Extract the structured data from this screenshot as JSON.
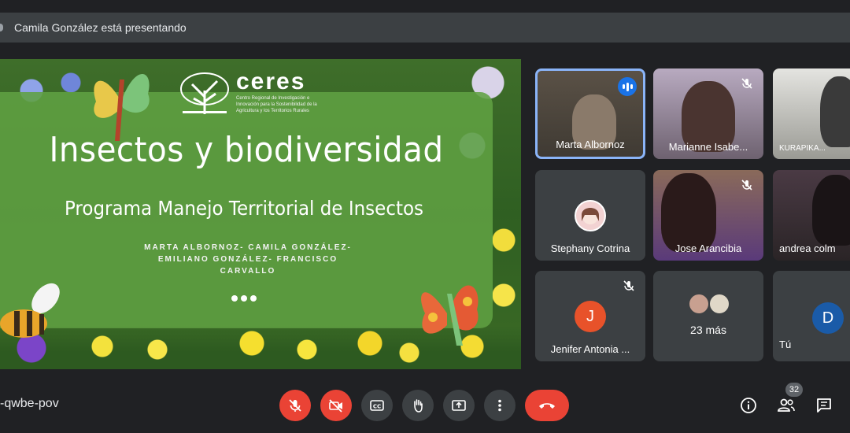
{
  "presenting": {
    "text": "Camila González está presentando"
  },
  "slide": {
    "logo_name": "ceres",
    "logo_subtitle": "Centro Regional de Investigación e Innovación para la Sostenibilidad de la Agricultura y los Territorios Rurales",
    "title": "Insectos y biodiversidad",
    "subtitle": "Programa Manejo Territorial de Insectos",
    "authors": "MARTA ALBORNOZ- CAMILA GONZÁLEZ- EMILIANO GONZÁLEZ- FRANCISCO CARVALLO"
  },
  "participants": [
    {
      "name": "Marta Albornoz",
      "state": "speaking"
    },
    {
      "name": "Marianne Isabe...",
      "state": "muted"
    },
    {
      "name": "KURAPIKA...",
      "state": "video"
    },
    {
      "name": "Stephany Cotrina",
      "state": "avatar"
    },
    {
      "name": "Jose Arancibia",
      "state": "muted"
    },
    {
      "name": "andrea colm",
      "state": "video"
    },
    {
      "name": "Jenifer Antonia ...",
      "initial": "J",
      "avatar_color": "#e8522a",
      "state": "muted"
    },
    {
      "name": "23 más",
      "state": "more"
    },
    {
      "name": "Tú",
      "initial": "D",
      "avatar_color": "#1a5ba8",
      "state": "self"
    }
  ],
  "meeting": {
    "code": "-qwbe-pov",
    "participant_count": "32"
  },
  "colors": {
    "danger": "#ea4335",
    "control_bg": "#3c4043",
    "accent": "#1a73e8",
    "background": "#202124"
  },
  "icons": {
    "mic": "mic-off-icon",
    "camera": "camera-off-icon",
    "captions": "closed-captions-icon",
    "hand": "raise-hand-icon",
    "present": "present-screen-icon",
    "more": "more-options-icon",
    "hangup": "hang-up-icon",
    "info": "info-icon",
    "people": "people-icon",
    "chat": "chat-icon"
  }
}
